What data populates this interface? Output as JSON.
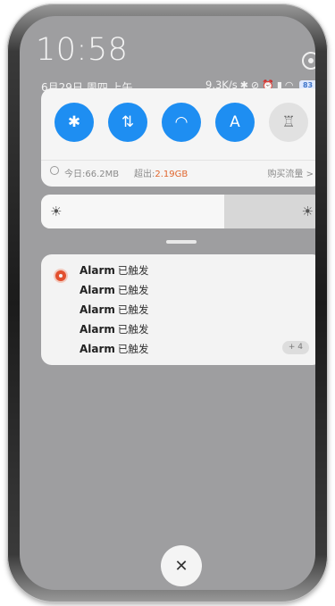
{
  "status": {
    "time": "10:58",
    "date": "6月29日 周四 上午",
    "net_speed": "9.3K/s",
    "icons": [
      "bluetooth-icon",
      "mute-icon",
      "alarm-icon",
      "signal-icon",
      "wifi-icon",
      "battery-icon"
    ],
    "battery": "83"
  },
  "quick_settings": {
    "tiles": [
      {
        "name": "bluetooth",
        "glyph": "✱",
        "active": true
      },
      {
        "name": "mobile-data",
        "glyph": "⇅",
        "active": true
      },
      {
        "name": "wifi",
        "glyph": "◠",
        "active": true
      },
      {
        "name": "auto-brightness",
        "glyph": "A",
        "active": true
      },
      {
        "name": "flashlight",
        "glyph": "♖",
        "active": false
      }
    ],
    "data_today": "今日:66.2MB",
    "data_over_label": "超出:",
    "data_over_value": "2.19GB",
    "buy_data": "购买流量 >"
  },
  "brightness": {
    "level": 0.65
  },
  "notification": {
    "app_icon": "alarm-clock-icon",
    "items": [
      {
        "title": "Alarm",
        "status": "已触发"
      },
      {
        "title": "Alarm",
        "status": "已触发"
      },
      {
        "title": "Alarm",
        "status": "已触发"
      },
      {
        "title": "Alarm",
        "status": "已触发"
      },
      {
        "title": "Alarm",
        "status": "已触发"
      }
    ],
    "more": "+ 4"
  },
  "colors": {
    "accent": "#1e8ef2",
    "warning": "#e0662e"
  }
}
